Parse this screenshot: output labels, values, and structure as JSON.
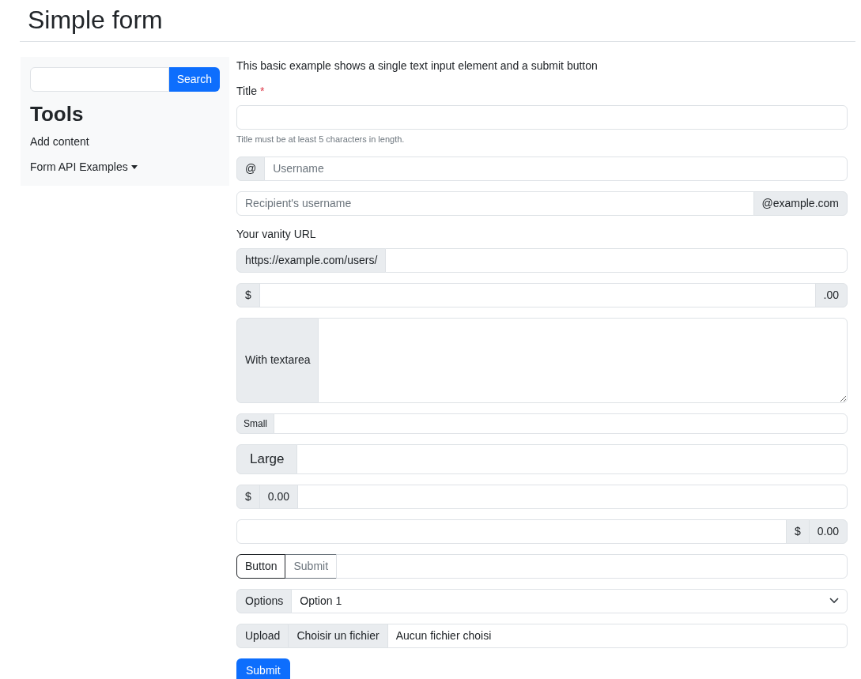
{
  "page_title": "Simple form",
  "sidebar": {
    "search": {
      "button": "Search"
    },
    "heading": "Tools",
    "links": [
      {
        "label": "Add content",
        "dropdown": false
      },
      {
        "label": "Form API Examples",
        "dropdown": true
      }
    ]
  },
  "intro": "This basic example shows a single text input element and a submit button",
  "rows": [
    {
      "kind": "group",
      "label": "Title",
      "required_mark": "*",
      "help": "Title must be at least 5 characters in length.",
      "parts": [
        {
          "kind": "input"
        }
      ]
    },
    {
      "kind": "group",
      "parts": [
        {
          "kind": "addon",
          "text": "@"
        },
        {
          "kind": "input",
          "placeholder": "Username"
        }
      ]
    },
    {
      "kind": "group",
      "parts": [
        {
          "kind": "input",
          "placeholder": "Recipient's username"
        },
        {
          "kind": "addon",
          "text": "@example.com"
        }
      ]
    },
    {
      "kind": "group",
      "label": "Your vanity URL",
      "parts": [
        {
          "kind": "addon",
          "text": "https://example.com/users/"
        },
        {
          "kind": "input"
        }
      ]
    },
    {
      "kind": "group",
      "parts": [
        {
          "kind": "addon",
          "text": "$"
        },
        {
          "kind": "input"
        },
        {
          "kind": "addon",
          "text": ".00"
        }
      ]
    },
    {
      "kind": "group",
      "parts": [
        {
          "kind": "addon",
          "text": "With textarea"
        },
        {
          "kind": "textarea"
        }
      ]
    },
    {
      "kind": "small",
      "parts": [
        {
          "kind": "addon",
          "text": "Small"
        },
        {
          "kind": "input"
        }
      ]
    },
    {
      "kind": "large",
      "parts": [
        {
          "kind": "addon",
          "text": "Large"
        },
        {
          "kind": "input"
        }
      ]
    },
    {
      "kind": "group",
      "parts": [
        {
          "kind": "addon",
          "text": "$"
        },
        {
          "kind": "addon",
          "text": "0.00"
        },
        {
          "kind": "input"
        }
      ]
    },
    {
      "kind": "group",
      "parts": [
        {
          "kind": "input"
        },
        {
          "kind": "addon",
          "text": "$"
        },
        {
          "kind": "addon",
          "text": "0.00"
        }
      ]
    },
    {
      "kind": "group",
      "parts": [
        {
          "kind": "button",
          "text": "Button"
        },
        {
          "kind": "button",
          "text": "Submit"
        },
        {
          "kind": "input"
        }
      ]
    },
    {
      "kind": "group",
      "parts": [
        {
          "kind": "addon",
          "text": "Options"
        },
        {
          "kind": "select",
          "value": "Option 1"
        }
      ]
    },
    {
      "kind": "group",
      "parts": [
        {
          "kind": "addon",
          "text": "Upload"
        },
        {
          "kind": "file",
          "button": "Choisir un fichier",
          "status": "Aucun fichier choisi"
        }
      ]
    }
  ],
  "submit": "Submit"
}
